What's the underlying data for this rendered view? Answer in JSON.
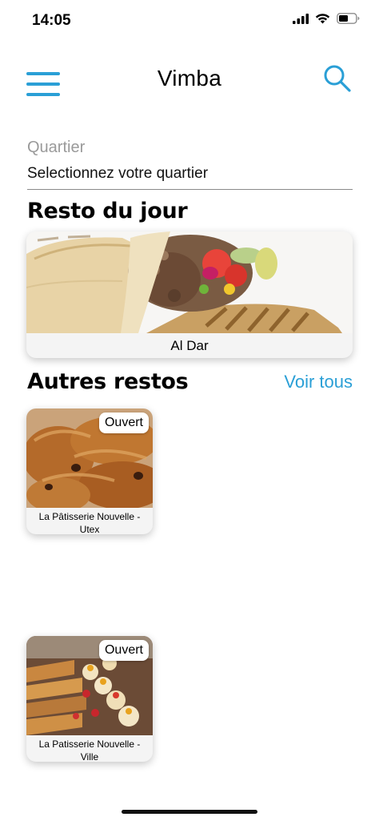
{
  "status_bar": {
    "time": "14:05"
  },
  "header": {
    "title": "Vimba",
    "menu_icon": "hamburger-menu-icon",
    "search_icon": "search-icon"
  },
  "filter": {
    "label": "Quartier",
    "value": "Selectionnez votre quartier"
  },
  "featured": {
    "section_title": "Resto du jour",
    "name": "Al Dar"
  },
  "others": {
    "section_title": "Autres restos",
    "see_all": "Voir tous",
    "items": [
      {
        "name": "La Pâtisserie Nouvelle - Utex",
        "badge": "Ouvert"
      },
      {
        "name": "La Patisserie Nouvelle - Ville",
        "badge": "Ouvert"
      }
    ]
  },
  "colors": {
    "accent": "#2a9fd6",
    "divider": "#8a8a8a",
    "muted": "#9a9a9a"
  }
}
